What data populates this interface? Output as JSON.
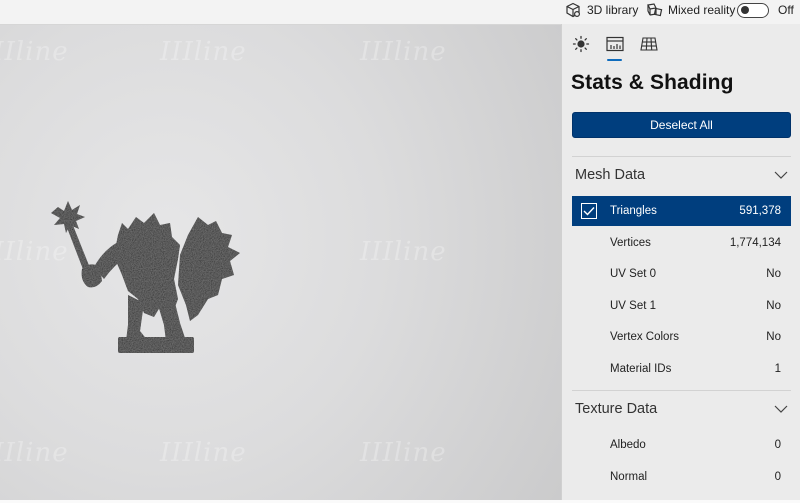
{
  "topbar": {
    "library_label": "3D library",
    "mixed_reality_label": "Mixed reality",
    "mixed_reality_state": "Off",
    "mixed_reality_on": false,
    "icons": {
      "library": "cube-icon",
      "mixed_reality": "mixed-reality-cubes-icon"
    }
  },
  "viewport": {
    "watermark_text": "IIIline",
    "model": "orc-warrior-figurine"
  },
  "panel": {
    "tabs": [
      {
        "name": "lighting",
        "icon": "sun-icon",
        "active": false
      },
      {
        "name": "stats",
        "icon": "stats-chart-icon",
        "active": true
      },
      {
        "name": "grid",
        "icon": "grid-icon",
        "active": false
      }
    ],
    "title": "Stats & Shading",
    "deselect_label": "Deselect All",
    "accent_color": "#003e7e",
    "mesh_section": {
      "title": "Mesh Data",
      "rows": [
        {
          "label": "Triangles",
          "value": "591,378",
          "selected": true
        },
        {
          "label": "Vertices",
          "value": "1,774,134",
          "selected": false
        },
        {
          "label": "UV Set 0",
          "value": "No",
          "selected": false
        },
        {
          "label": "UV Set 1",
          "value": "No",
          "selected": false
        },
        {
          "label": "Vertex Colors",
          "value": "No",
          "selected": false
        },
        {
          "label": "Material IDs",
          "value": "1",
          "selected": false
        }
      ]
    },
    "texture_section": {
      "title": "Texture Data",
      "rows": [
        {
          "label": "Albedo",
          "value": "0"
        },
        {
          "label": "Normal",
          "value": "0"
        }
      ]
    }
  }
}
